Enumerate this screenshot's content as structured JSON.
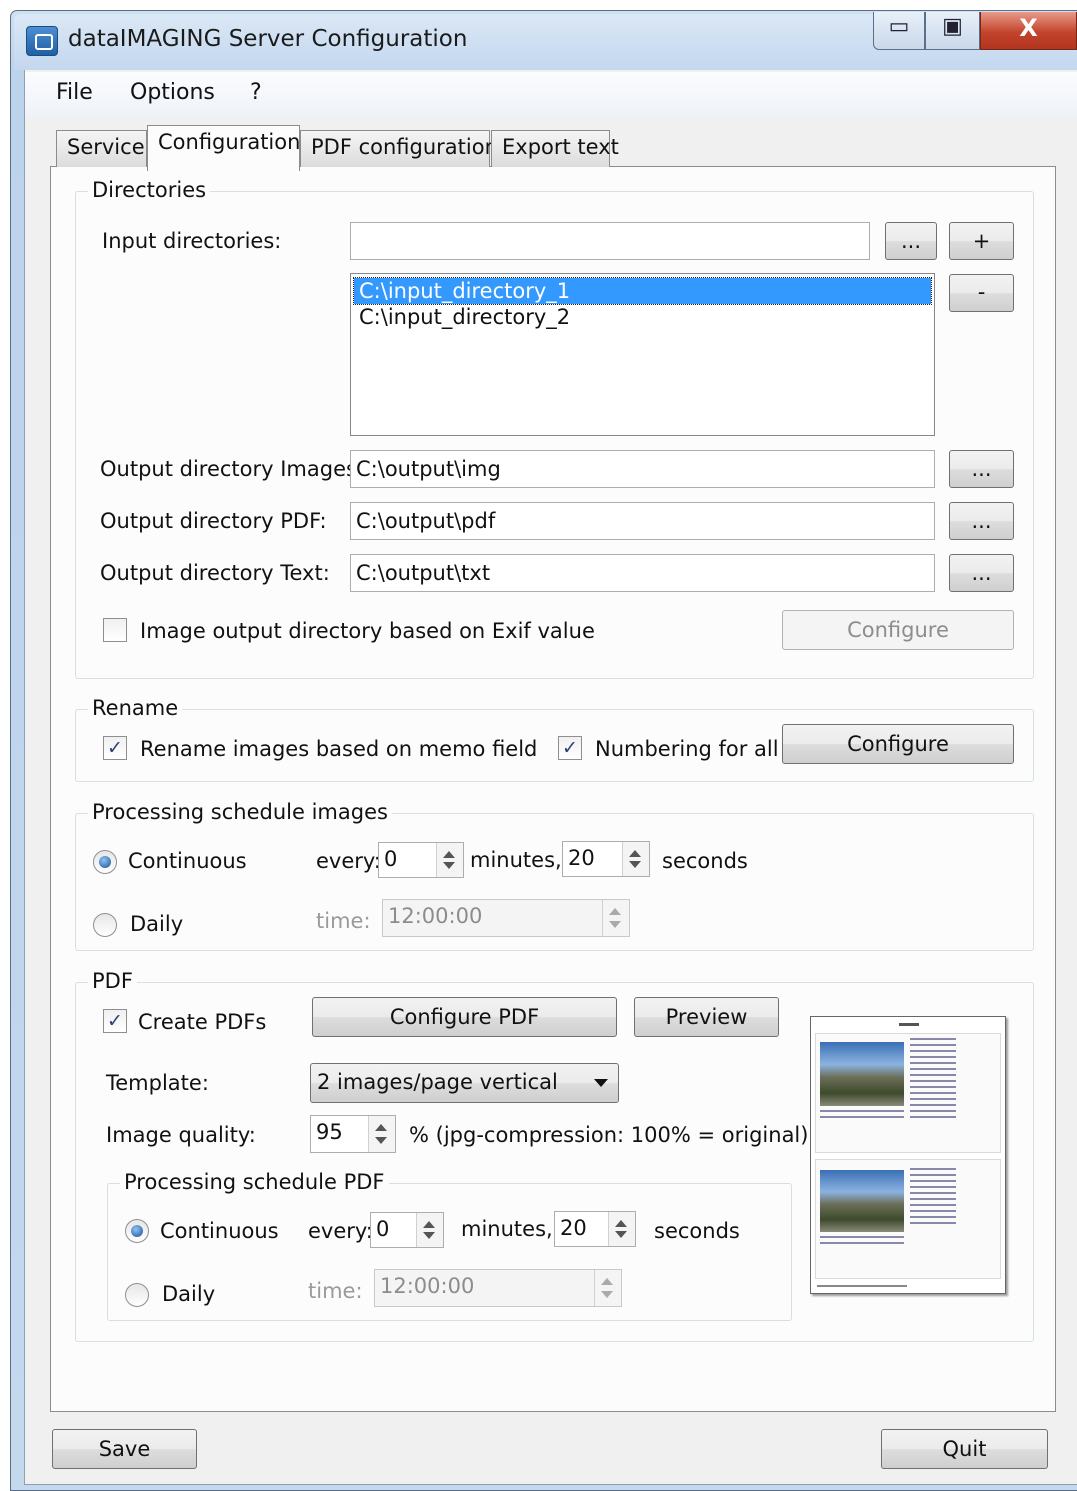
{
  "window": {
    "title": "dataIMAGING Server Configuration",
    "caption_min": "▭",
    "caption_max": "▣",
    "caption_close": "X"
  },
  "menu": [
    "File",
    "Options",
    "?"
  ],
  "tabs": [
    "Service",
    "Configuration",
    "PDF configuration",
    "Export text"
  ],
  "active_tab": "Configuration",
  "directories": {
    "group_label": "Directories",
    "input_label": "Input directories:",
    "input_value": "",
    "browse_label": "...",
    "add_label": "+",
    "remove_label": "-",
    "input_list": [
      "C:\\input_directory_1",
      "C:\\input_directory_2"
    ],
    "selected_index": 0,
    "out_images_label": "Output directory Images:",
    "out_images_value": "C:\\output\\img",
    "out_pdf_label": "Output directory PDF:",
    "out_pdf_value": "C:\\output\\pdf",
    "out_text_label": "Output directory Text:",
    "out_text_value": "C:\\output\\txt",
    "exif_label": "Image output directory based on Exif value",
    "exif_checked": false,
    "configure_label": "Configure"
  },
  "rename": {
    "group_label": "Rename",
    "memo_label": "Rename images based on memo field",
    "memo_checked": true,
    "numbering_label": "Numbering for all",
    "numbering_checked": true,
    "configure_label": "Configure"
  },
  "schedule_images": {
    "group_label": "Processing schedule images",
    "continuous_label": "Continuous",
    "daily_label": "Daily",
    "selected": "Continuous",
    "every_label": "every:",
    "minutes_value": "0",
    "minutes_label": "minutes,",
    "seconds_value": "20",
    "seconds_label": "seconds",
    "time_label": "time:",
    "time_value": "12:00:00"
  },
  "pdf": {
    "group_label": "PDF",
    "create_label": "Create PDFs",
    "create_checked": true,
    "configure_pdf_label": "Configure PDF",
    "preview_label": "Preview",
    "template_label": "Template:",
    "template_value": "2 images/page vertical",
    "quality_label": "Image quality:",
    "quality_value": "95",
    "quality_note": "% (jpg-compression: 100% = original)",
    "schedule": {
      "group_label": "Processing schedule PDF",
      "continuous_label": "Continuous",
      "daily_label": "Daily",
      "selected": "Continuous",
      "every_label": "every:",
      "minutes_value": "0",
      "minutes_label": "minutes,",
      "seconds_value": "20",
      "seconds_label": "seconds",
      "time_label": "time:",
      "time_value": "12:00:00"
    }
  },
  "footer": {
    "save_label": "Save",
    "quit_label": "Quit"
  },
  "colors": {
    "selection": "#3399ff",
    "window_frame": "#c4d8ee",
    "close_button": "#c3442c"
  }
}
